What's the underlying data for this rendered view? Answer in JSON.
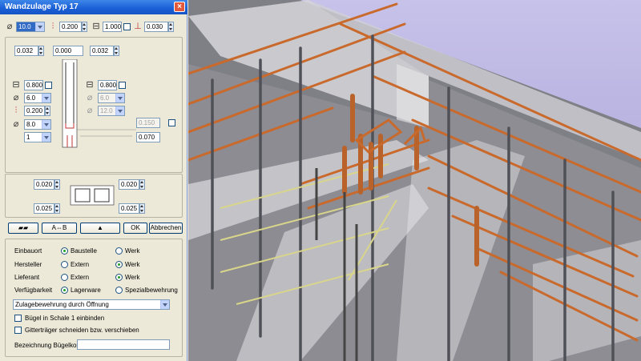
{
  "dialog": {
    "title": "Wandzulage Typ 17",
    "top_row": {
      "diameter": "10.0",
      "spacing": "0.200",
      "length": "1.000",
      "offset": "0.030"
    },
    "upper": {
      "left": "0.032",
      "mid": "0.000",
      "right": "0.032"
    },
    "left_col": {
      "cover": "0.800",
      "dia1": "6.0",
      "spacing": "0.200",
      "dia2": "8.0",
      "count": "1"
    },
    "right_col": {
      "cover": "0.800",
      "dia1": "6.0",
      "dia2": "12.0"
    },
    "right_fields": {
      "a": "0.150",
      "b": "0.070"
    },
    "lower": {
      "tl": "0.020",
      "tr": "0.020",
      "bl": "0.025",
      "br": "0.025"
    },
    "buttons": {
      "ok": "OK",
      "cancel": "Abbrechen",
      "swap": "A⇔B"
    },
    "options": {
      "einbauort": {
        "label": "Einbauort",
        "opt1": "Baustelle",
        "opt2": "Werk"
      },
      "hersteller": {
        "label": "Hersteller",
        "opt1": "Extern",
        "opt2": "Werk"
      },
      "lieferant": {
        "label": "Lieferant",
        "opt1": "Extern",
        "opt2": "Werk"
      },
      "verfuegbarkeit": {
        "label": "Verfügbarkeit",
        "opt1": "Lagerware",
        "opt2": "Spezialbewehrung"
      }
    },
    "combo": "Zulagebewehrung durch Öffnung",
    "check1": "Bügel in Schale 1 einbinden",
    "check2": "Gitterträger schneiden bzw. verschieben",
    "bez_label": "Bezeichnung Bügelkorb",
    "bez_value": ""
  },
  "icons": [
    "diameter-icon",
    "spacing-icon",
    "length-icon",
    "offset-icon",
    "close-icon",
    "chevron-down-icon"
  ]
}
